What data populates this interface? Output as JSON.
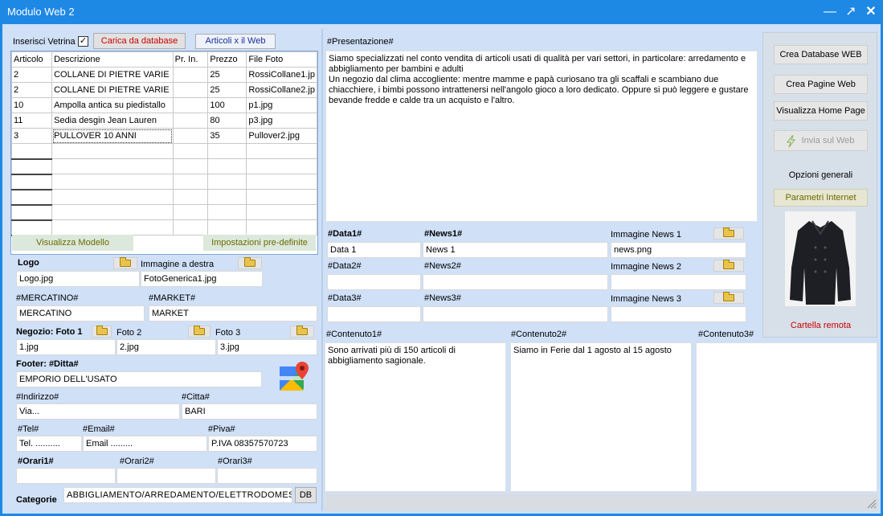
{
  "window": {
    "title": "Modulo Web 2"
  },
  "left": {
    "inserisci_vetrina": "Inserisci Vetrina",
    "carica_btn": "Carica da database",
    "articoli_btn": "Articoli x il Web",
    "grid": {
      "headers": [
        "Articolo",
        "Descrizione",
        "Pr. In.",
        "Prezzo",
        "File Foto"
      ],
      "rows": [
        [
          "2",
          "COLLANE DI PIETRE VARIE",
          "",
          "25",
          "RossiCollane1.jp"
        ],
        [
          "2",
          "COLLANE DI PIETRE VARIE",
          "",
          "25",
          "RossiCollane2.jp"
        ],
        [
          "10",
          "Ampolla antica su piedistallo",
          "",
          "100",
          "p1.jpg"
        ],
        [
          "11",
          "Sedia desgin Jean Lauren",
          "",
          "80",
          "p3.jpg"
        ],
        [
          "3",
          "PULLOVER 10 ANNI",
          "",
          "35",
          "Pullover2.jpg"
        ]
      ]
    },
    "visualizza_modello": "Visualizza Modello",
    "impostazioni": "Impostazioni pre-definite",
    "logo_label": "Logo",
    "immagine_destra_label": "Immagine a destra",
    "logo_value": "Logo.jpg",
    "immagine_destra_value": "FotoGenerica1.jpg",
    "mercatino_label": "#MERCATINO#",
    "market_label": "#MARKET#",
    "mercatino_value": "MERCATINO",
    "market_value": "MARKET",
    "negozio_label": "Negozio: Foto 1",
    "foto2_label": "Foto 2",
    "foto3_label": "Foto 3",
    "foto1_value": "1.jpg",
    "foto2_value": "2.jpg",
    "foto3_value": "3.jpg",
    "footer_label": "Footer:  #Ditta#",
    "ditta_value": "EMPORIO DELL'USATO",
    "indirizzo_label": "#Indirizzo#",
    "citta_label": "#Citta#",
    "indirizzo_value": "Via...",
    "citta_value": "BARI",
    "tel_label": "#Tel#",
    "email_label": "#Email#",
    "piva_label": "#Piva#",
    "tel_value": "Tel. ..........",
    "email_value": "Email .........",
    "piva_value": "P.IVA 08357570723",
    "orari1_label": "#Orari1#",
    "orari2_label": "#Orari2#",
    "orari3_label": "#Orari3#",
    "categorie_label": "Categorie",
    "categorie_value": "ABBIGLIAMENTO/ARREDAMENTO/ELETTRODOMESTI",
    "db_btn": "DB"
  },
  "center": {
    "presentazione_label": "#Presentazione#",
    "presentazione_text": "Siamo specializzati nel conto vendita di articoli usati di qualità per vari settori, in particolare: arredamento e abbigliamento per bambini e adulti\nUn negozio dal clima accogliente: mentre mamme e papà curiosano tra gli scaffali e scambiano due chiacchiere, i bimbi possono intrattenersi nell'angolo gioco a loro dedicato. Oppure si può leggere e gustare bevande fredde e calde tra un acquisto e l'altro.",
    "data1_label": "#Data1#",
    "news1_label": "#News1#",
    "img_news1_label": "Immagine News 1",
    "data1_value": "Data 1",
    "news1_value": "News 1",
    "img_news1_value": "news.png",
    "data2_label": "#Data2#",
    "news2_label": "#News2#",
    "img_news2_label": "Immagine News 2",
    "data3_label": "#Data3#",
    "news3_label": "#News3#",
    "img_news3_label": "Immagine News 3",
    "contenuto1_label": "#Contenuto1#",
    "contenuto2_label": "#Contenuto2#",
    "contenuto3_label": "#Contenuto3#",
    "contenuto1_text": "Sono arrivati più di 150 articoli di abbigliamento sagionale.",
    "contenuto2_text": "Siamo in Ferie dal 1 agosto al 15 agosto",
    "contenuto3_text": ""
  },
  "right": {
    "crea_db": "Crea Database WEB",
    "crea_pagine": "Crea Pagine Web",
    "visualizza_home": "Visualizza Home Page",
    "invia": "Invia sul Web",
    "opzioni": "Opzioni generali",
    "parametri": "Parametri Internet",
    "cartella": "Cartella remota"
  },
  "colors": {
    "titlebar": "#1e88e5",
    "client": "#cfe0f7",
    "red_text": "#cc0000",
    "olive_text": "#6b6b00"
  }
}
